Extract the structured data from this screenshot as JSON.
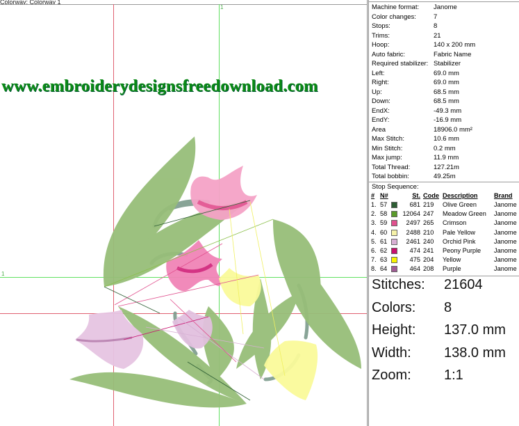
{
  "canvas": {
    "topbar_text": "Colorway: Colorway 1",
    "watermark": "www.embroiderydesignsfreedownload.com",
    "axis_label_top": "1",
    "axis_label_left": "1"
  },
  "info": [
    {
      "label": "Machine format:",
      "value": "Janome"
    },
    {
      "label": "Color changes:",
      "value": "7"
    },
    {
      "label": "Stops:",
      "value": "8"
    },
    {
      "label": "Trims:",
      "value": "21"
    },
    {
      "label": "Hoop:",
      "value": "140 x 200 mm"
    },
    {
      "label": "Auto fabric:",
      "value": "Fabric Name"
    },
    {
      "label": "Required stabilizer:",
      "value": "Stabilizer"
    },
    {
      "label": "Left:",
      "value": "69.0 mm"
    },
    {
      "label": "Right:",
      "value": "69.0 mm"
    },
    {
      "label": "Up:",
      "value": "68.5 mm"
    },
    {
      "label": "Down:",
      "value": "68.5 mm"
    },
    {
      "label": "EndX:",
      "value": "-49.3 mm"
    },
    {
      "label": "EndY:",
      "value": "-16.9 mm"
    },
    {
      "label": "Area",
      "value": "18906.0 mm²"
    },
    {
      "label": "Max Stitch:",
      "value": "10.6 mm"
    },
    {
      "label": "Min Stitch:",
      "value": "0.2 mm"
    },
    {
      "label": "Max jump:",
      "value": "11.9 mm"
    },
    {
      "label": "Total Thread:",
      "value": "127.21m"
    },
    {
      "label": "Total bobbin:",
      "value": "49.25m"
    }
  ],
  "stop_sequence": {
    "title": "Stop Sequence:",
    "headers": {
      "idx": "#",
      "n": "N#",
      "st": "St.",
      "code": "Code",
      "desc": "Description",
      "brand": "Brand"
    },
    "rows": [
      {
        "idx": "1.",
        "n": "57",
        "color": "#2e5e34",
        "st": "681",
        "code": "219",
        "desc": "Olive Green",
        "brand": "Janome"
      },
      {
        "idx": "2.",
        "n": "58",
        "color": "#5a9a2a",
        "st": "12064",
        "code": "247",
        "desc": "Meadow Green",
        "brand": "Janome"
      },
      {
        "idx": "3.",
        "n": "59",
        "color": "#e0508e",
        "st": "2497",
        "code": "265",
        "desc": "Crimson",
        "brand": "Janome"
      },
      {
        "idx": "4.",
        "n": "60",
        "color": "#f6f2a8",
        "st": "2488",
        "code": "210",
        "desc": "Pale Yellow",
        "brand": "Janome"
      },
      {
        "idx": "5.",
        "n": "61",
        "color": "#d8b0d4",
        "st": "2461",
        "code": "240",
        "desc": "Orchid Pink",
        "brand": "Janome"
      },
      {
        "idx": "6.",
        "n": "62",
        "color": "#c8106e",
        "st": "474",
        "code": "241",
        "desc": "Peony Purple",
        "brand": "Janome"
      },
      {
        "idx": "7.",
        "n": "63",
        "color": "#f8f400",
        "st": "475",
        "code": "204",
        "desc": "Yellow",
        "brand": "Janome"
      },
      {
        "idx": "8.",
        "n": "64",
        "color": "#a05c94",
        "st": "464",
        "code": "208",
        "desc": "Purple",
        "brand": "Janome"
      }
    ]
  },
  "summary": [
    {
      "label": "Stitches:",
      "value": "21604"
    },
    {
      "label": "Colors:",
      "value": "8"
    },
    {
      "label": "Height:",
      "value": "137.0 mm"
    },
    {
      "label": "Width:",
      "value": "138.0 mm"
    },
    {
      "label": "Zoom:",
      "value": "1:1"
    }
  ]
}
